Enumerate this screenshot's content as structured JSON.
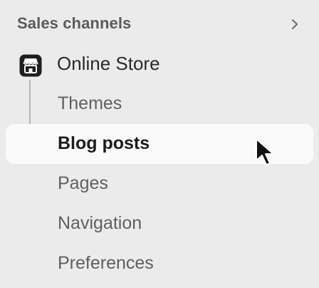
{
  "section": {
    "title": "Sales channels",
    "chevron_icon": "chevron-right-icon"
  },
  "channel": {
    "label": "Online Store",
    "icon": "storefront-icon"
  },
  "sub_items": [
    {
      "label": "Themes",
      "active": false
    },
    {
      "label": "Blog posts",
      "active": true
    },
    {
      "label": "Pages",
      "active": false
    },
    {
      "label": "Navigation",
      "active": false
    },
    {
      "label": "Preferences",
      "active": false
    }
  ],
  "colors": {
    "background": "#ebebeb",
    "active_row": "#fafafa",
    "text_primary": "#1c1c1c",
    "text_secondary": "#606060",
    "connector": "#b5b5b5"
  },
  "cursor": {
    "icon": "mouse-pointer-icon"
  }
}
